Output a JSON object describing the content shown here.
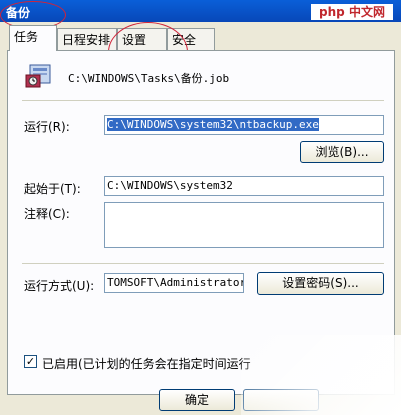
{
  "window": {
    "title": "备份"
  },
  "watermark": "php 中文网",
  "tabs": [
    {
      "label": "任务"
    },
    {
      "label": "日程安排"
    },
    {
      "label": "设置"
    },
    {
      "label": "安全"
    }
  ],
  "task": {
    "path": "C:\\WINDOWS\\Tasks\\备份.job",
    "run_label": "运行(R):",
    "run_value": "C:\\WINDOWS\\system32\\ntbackup.exe",
    "browse_label": "浏览(B)...",
    "start_in_label": "起始于(T):",
    "start_in_value": "C:\\WINDOWS\\system32",
    "comment_label": "注释(C):",
    "comment_value": "",
    "run_as_label": "运行方式(U):",
    "run_as_value": "TOMSOFT\\Administrator",
    "set_password_label": "设置密码(S)...",
    "enabled_label": "已启用(已计划的任务会在指定时间运行",
    "enabled": true
  },
  "footer": {
    "ok_label": "确定"
  }
}
